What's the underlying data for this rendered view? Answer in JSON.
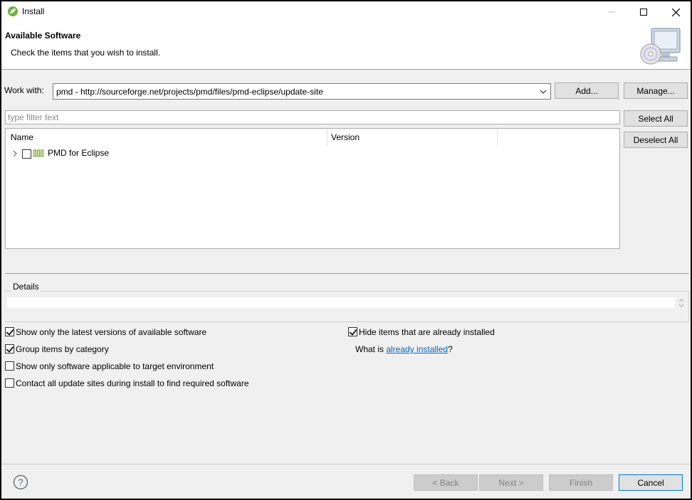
{
  "window": {
    "title": "Install",
    "controls": [
      "minimize-icon",
      "maximize-icon",
      "close-icon"
    ]
  },
  "header": {
    "title": "Available Software",
    "description": "Check the items that you wish to install."
  },
  "work_with": {
    "label": "Work with:",
    "value": "pmd - http://sourceforge.net/projects/pmd/files/pmd-eclipse/update-site",
    "add_label": "Add...",
    "manage_label": "Manage..."
  },
  "filter": {
    "placeholder": "type filter text"
  },
  "buttons": {
    "select_all": "Select All",
    "deselect_all": "Deselect All"
  },
  "tree": {
    "columns": [
      "Name",
      "Version"
    ],
    "items": [
      {
        "name": "PMD for Eclipse",
        "version": "",
        "checked": false,
        "expandable": true
      }
    ]
  },
  "details": {
    "label": "Details",
    "text": ""
  },
  "options": {
    "latest_versions": {
      "label": "Show only the latest versions of available software",
      "checked": true
    },
    "group_by_category": {
      "label": "Group items by category",
      "checked": true
    },
    "applicable_only": {
      "label": "Show only software applicable to target environment",
      "checked": false
    },
    "contact_all_sites": {
      "label": "Contact all update sites during install to find required software",
      "checked": false
    },
    "hide_installed": {
      "label": "Hide items that are already installed",
      "checked": true
    },
    "what_is_prefix": "What is ",
    "what_is_link": "already installed",
    "what_is_suffix": "?"
  },
  "footer": {
    "back": "< Back",
    "next": "Next >",
    "finish": "Finish",
    "cancel": "Cancel"
  },
  "colors": {
    "accent": "#0078d7",
    "link": "#0066cc",
    "dialog_bg": "#f0f0f0"
  }
}
